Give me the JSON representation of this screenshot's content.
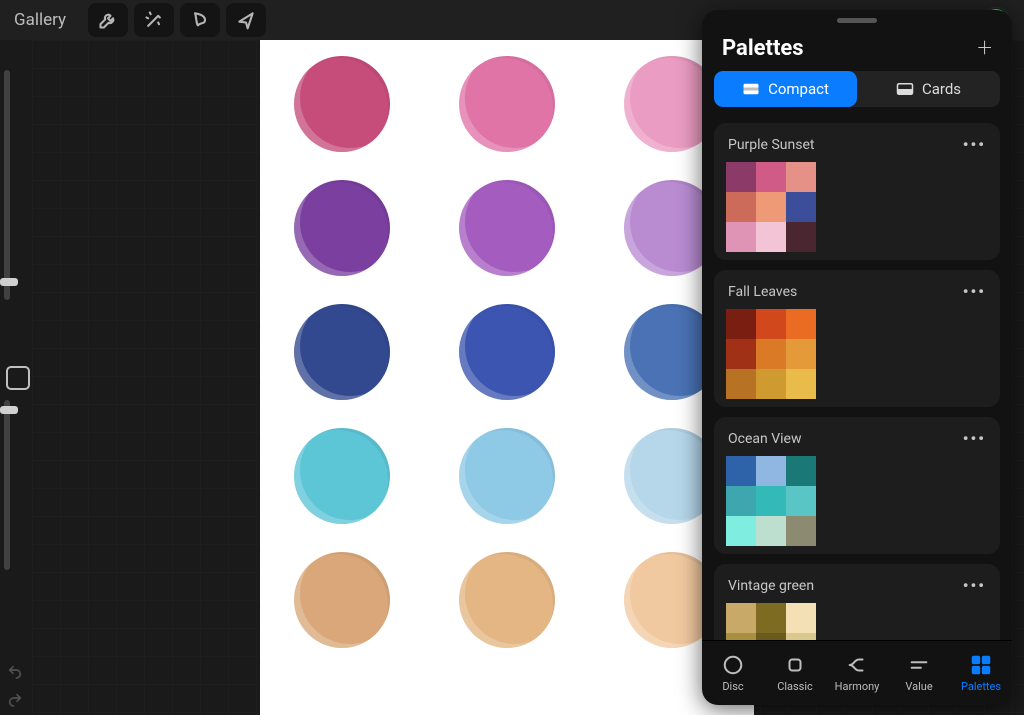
{
  "topbar": {
    "gallery_label": "Gallery",
    "active_color": "#16e03b"
  },
  "panel": {
    "title": "Palettes",
    "views": {
      "compact": "Compact",
      "cards": "Cards"
    },
    "tabs": [
      {
        "label": "Disc"
      },
      {
        "label": "Classic"
      },
      {
        "label": "Harmony"
      },
      {
        "label": "Value"
      },
      {
        "label": "Palettes"
      }
    ],
    "palettes": [
      {
        "name": "Purple Sunset",
        "swatches": [
          "#8c3a67",
          "#d05b86",
          "#e59188",
          "#cc6b5a",
          "#ee9a76",
          "#3c4e9a",
          "#df94b5",
          "#f3c4d5",
          "#4a2730"
        ]
      },
      {
        "name": "Fall Leaves",
        "swatches": [
          "#7a1e12",
          "#d0481b",
          "#ea6b22",
          "#a03116",
          "#da7a27",
          "#e49a38",
          "#b87224",
          "#cf9a30",
          "#e8bb4a"
        ]
      },
      {
        "name": "Ocean View",
        "swatches": [
          "#2f63a9",
          "#8fb7e1",
          "#1a7876",
          "#3da6af",
          "#34b9b9",
          "#5ac5c5",
          "#7fede0",
          "#bddfcf",
          "#8c8a70"
        ]
      },
      {
        "name": "Vintage green",
        "swatches": [
          "#c9a967",
          "#7d6b22",
          "#f3e0b4",
          "#a89040",
          "#6a5a1c",
          "#d9c98a"
        ]
      }
    ]
  },
  "canvas": {
    "dots": [
      [
        "#c64d7a",
        "#e074a7",
        "#eb9cc2"
      ],
      [
        "#7a3f9f",
        "#a45cbf",
        "#b98cd2"
      ],
      [
        "#33498f",
        "#3b55b1",
        "#4a72b5"
      ],
      [
        "#5cc5d6",
        "#8ec9e6",
        "#b6d7ea"
      ],
      [
        "#d9a779",
        "#e4b684",
        "#f1c9a0"
      ]
    ]
  }
}
